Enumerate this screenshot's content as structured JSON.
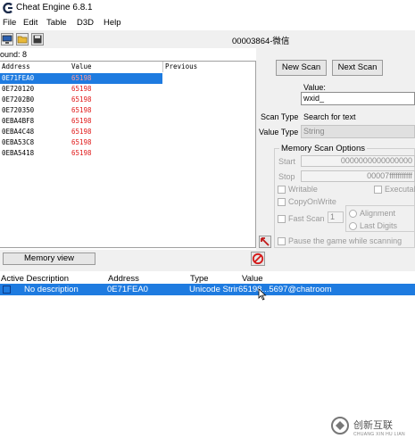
{
  "window": {
    "title": "Cheat Engine 6.8.1",
    "process": "00003864-微信"
  },
  "menu": [
    "File",
    "Edit",
    "Table",
    "D3D",
    "Help"
  ],
  "results": {
    "found": "ound: 8",
    "columns": [
      "Address",
      "Value",
      "Previous"
    ],
    "rows": [
      {
        "address": "0E71FEA0",
        "value": "65198"
      },
      {
        "address": "0E720120",
        "value": "65198"
      },
      {
        "address": "0E7202B0",
        "value": "65198"
      },
      {
        "address": "0E720350",
        "value": "65198"
      },
      {
        "address": "0EBA4BF8",
        "value": "65198"
      },
      {
        "address": "0EBA4C48",
        "value": "65198"
      },
      {
        "address": "0EBA53C8",
        "value": "65198"
      },
      {
        "address": "0EBA5418",
        "value": "65198"
      }
    ]
  },
  "scan": {
    "new_scan": "New Scan",
    "next_scan": "Next Scan",
    "value_label": "Value:",
    "value": "wxid_",
    "scan_type_label": "Scan Type",
    "scan_type": "Search for text",
    "value_type_label": "Value Type",
    "value_type": "String",
    "options_title": "Memory Scan Options",
    "start_label": "Start",
    "start_value": "0000000000000000",
    "stop_label": "Stop",
    "stop_value": "00007fffffffffff",
    "writable": "Writable",
    "executable": "Executal",
    "copy_on_write": "CopyOnWrite",
    "fast_scan": "Fast Scan",
    "fast_scan_value": "1",
    "alignment": "Alignment",
    "last_digits": "Last Digits",
    "pause_game": "Pause the game while scanning"
  },
  "memory_view": "Memory view",
  "address_list": {
    "columns": [
      "Active Description",
      "Address",
      "Type",
      "Value"
    ],
    "row": {
      "description": "No description",
      "address": "0E71FEA0",
      "type": "Unicode Strir",
      "value": "65198...5697@chatroom"
    }
  },
  "watermark": {
    "text": "创新互联",
    "sub": "CHUANG XIN HU LIAN"
  },
  "colors": {
    "selection": "#1e7be0",
    "value_red": "#e01919",
    "panel_bg": "#f0f0f0"
  }
}
